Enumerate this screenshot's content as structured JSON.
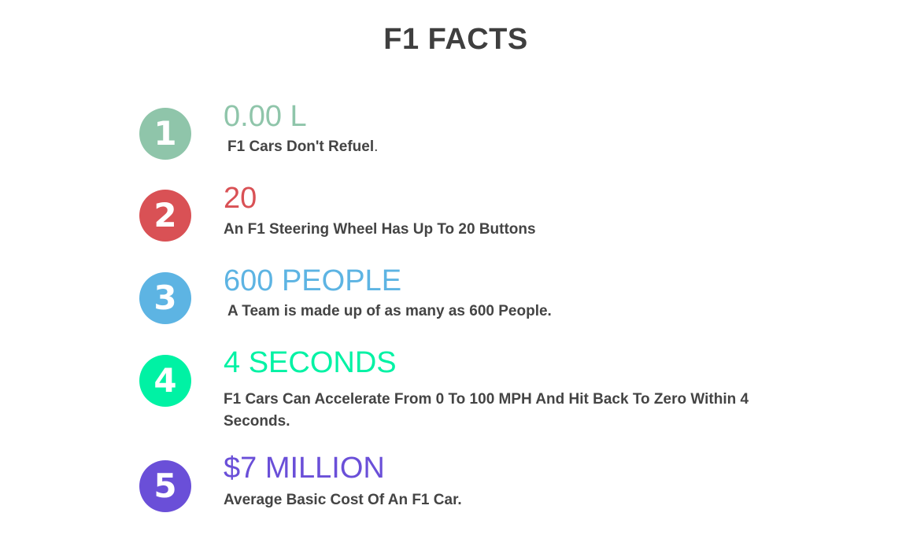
{
  "page": {
    "title": "F1 FACTS"
  },
  "facts": [
    {
      "number": "1",
      "stat": "0.00 L",
      "description": "F1 Cars Don't Refuel",
      "trailing": ".",
      "color": "#8fc5aa"
    },
    {
      "number": "2",
      "stat": "20",
      "description": "An F1 Steering Wheel Has Up To 20 Buttons",
      "color": "#d95155"
    },
    {
      "number": "3",
      "stat": "600 PEOPLE",
      "description": "A Team is made up of as many as 600 People.",
      "color": "#5db4e3"
    },
    {
      "number": "4",
      "stat": "4 SECONDS",
      "description": "F1 Cars Can Accelerate From 0 To 100 MPH And Hit Back To Zero Within 4 Seconds.",
      "color": "#00f2a4"
    },
    {
      "number": "5",
      "stat": "$7 MILLION",
      "description": "Average Basic Cost Of An F1 Car.",
      "color": "#6a4fd8"
    }
  ]
}
